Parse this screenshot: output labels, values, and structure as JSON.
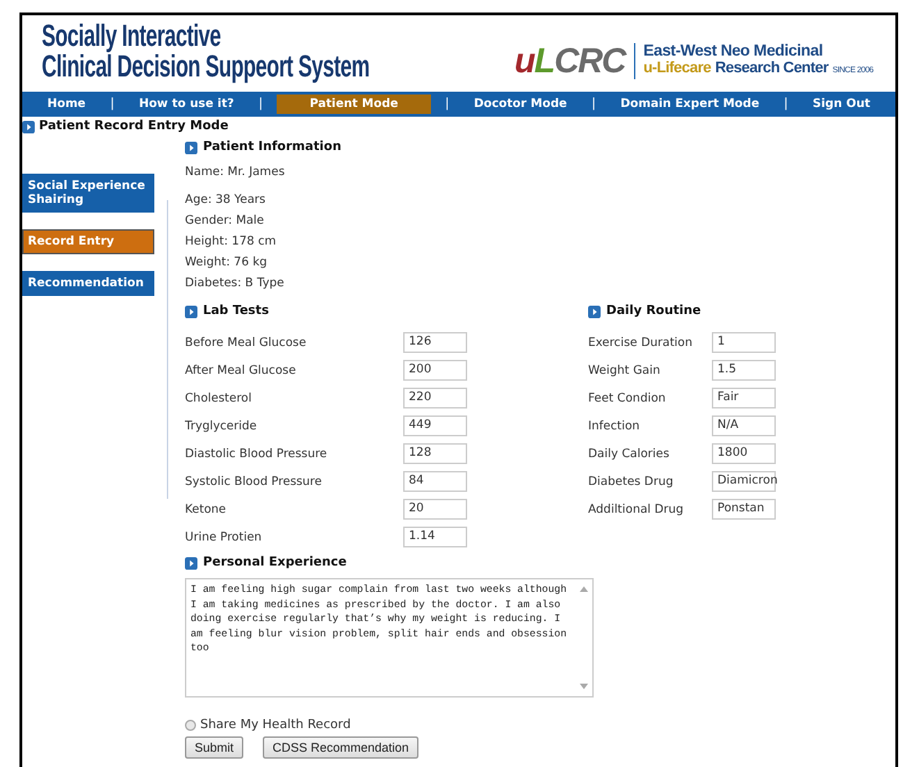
{
  "header": {
    "title_lines": [
      "Socially Interactive",
      "Clinical Decision Suppeort System"
    ],
    "logo": [
      {
        "text": "u",
        "color": "#a3282c"
      },
      {
        "text": "L",
        "color": "#5d9a2c"
      },
      {
        "text": "CRC",
        "color": "#6b6b6b"
      }
    ],
    "org_line1": "East-West Neo Medicinal",
    "org_line2": [
      {
        "kind": "accent",
        "text": "u-Lifecare"
      },
      {
        "kind": "plain",
        "text": "Research Center"
      },
      {
        "kind": "small",
        "text": "SINCE 2006"
      }
    ]
  },
  "nav": [
    {
      "kind": "link",
      "label": "Home",
      "selected": false
    },
    {
      "kind": "separator",
      "label": "|"
    },
    {
      "kind": "link",
      "label": "How to use it?",
      "selected": false
    },
    {
      "kind": "separator",
      "label": "|"
    },
    {
      "kind": "link",
      "label": "Patient Mode",
      "selected": true
    },
    {
      "kind": "separator",
      "label": "|"
    },
    {
      "kind": "link",
      "label": "Docotor Mode",
      "selected": false
    },
    {
      "kind": "separator",
      "label": "|"
    },
    {
      "kind": "link",
      "label": "Domain Expert Mode",
      "selected": false
    },
    {
      "kind": "separator",
      "label": "|"
    },
    {
      "kind": "link",
      "label": "Sign Out",
      "selected": false
    }
  ],
  "page_title": "Patient Record Entry Mode",
  "sidebar": {
    "items": [
      {
        "label": "Social Experience Shairing",
        "selected": false
      },
      {
        "label": "Record Entry",
        "selected": true
      },
      {
        "label": "Recommendation",
        "selected": false
      }
    ]
  },
  "patient_info": {
    "heading": "Patient Information",
    "name": "Name: Mr. James",
    "details": [
      "Age: 38 Years",
      "Gender: Male",
      "Height: 178 cm",
      "Weight: 76 kg",
      "Diabetes: B Type"
    ]
  },
  "lab_tests": {
    "heading": "Lab Tests",
    "rows": [
      {
        "label": "Before Meal Glucose",
        "value": "126"
      },
      {
        "label": "After Meal Glucose",
        "value": "200"
      },
      {
        "label": "Cholesterol",
        "value": "220"
      },
      {
        "label": "Tryglyceride",
        "value": "449"
      },
      {
        "label": "Diastolic Blood Pressure",
        "value": "128"
      },
      {
        "label": "Systolic Blood Pressure",
        "value": "84"
      },
      {
        "label": "Ketone",
        "value": "20"
      },
      {
        "label": "Urine Protien",
        "value": "1.14"
      }
    ]
  },
  "daily_routine": {
    "heading": "Daily Routine",
    "rows": [
      {
        "label": "Exercise Duration",
        "value": "1"
      },
      {
        "label": "Weight Gain",
        "value": "1.5"
      },
      {
        "label": "Feet Condion",
        "value": "Fair"
      },
      {
        "label": "Infection",
        "value": "N/A"
      },
      {
        "label": "Daily Calories",
        "value": "1800"
      },
      {
        "label": "Diabetes Drug",
        "value": "Diamicron"
      },
      {
        "label": "Addiltional Drug",
        "value": "Ponstan"
      }
    ]
  },
  "personal_experience": {
    "heading": "Personal Experience",
    "text": "I am feeling high sugar complain from last two weeks although I am taking medicines as prescribed by the doctor. I am also doing exercise regularly that’s why my weight is reducing. I am feeling blur vision problem, split hair ends and obsession too"
  },
  "share": {
    "label": "Share My Health Record",
    "checked": false
  },
  "buttons": [
    "Submit",
    "CDSS Recommendation"
  ]
}
